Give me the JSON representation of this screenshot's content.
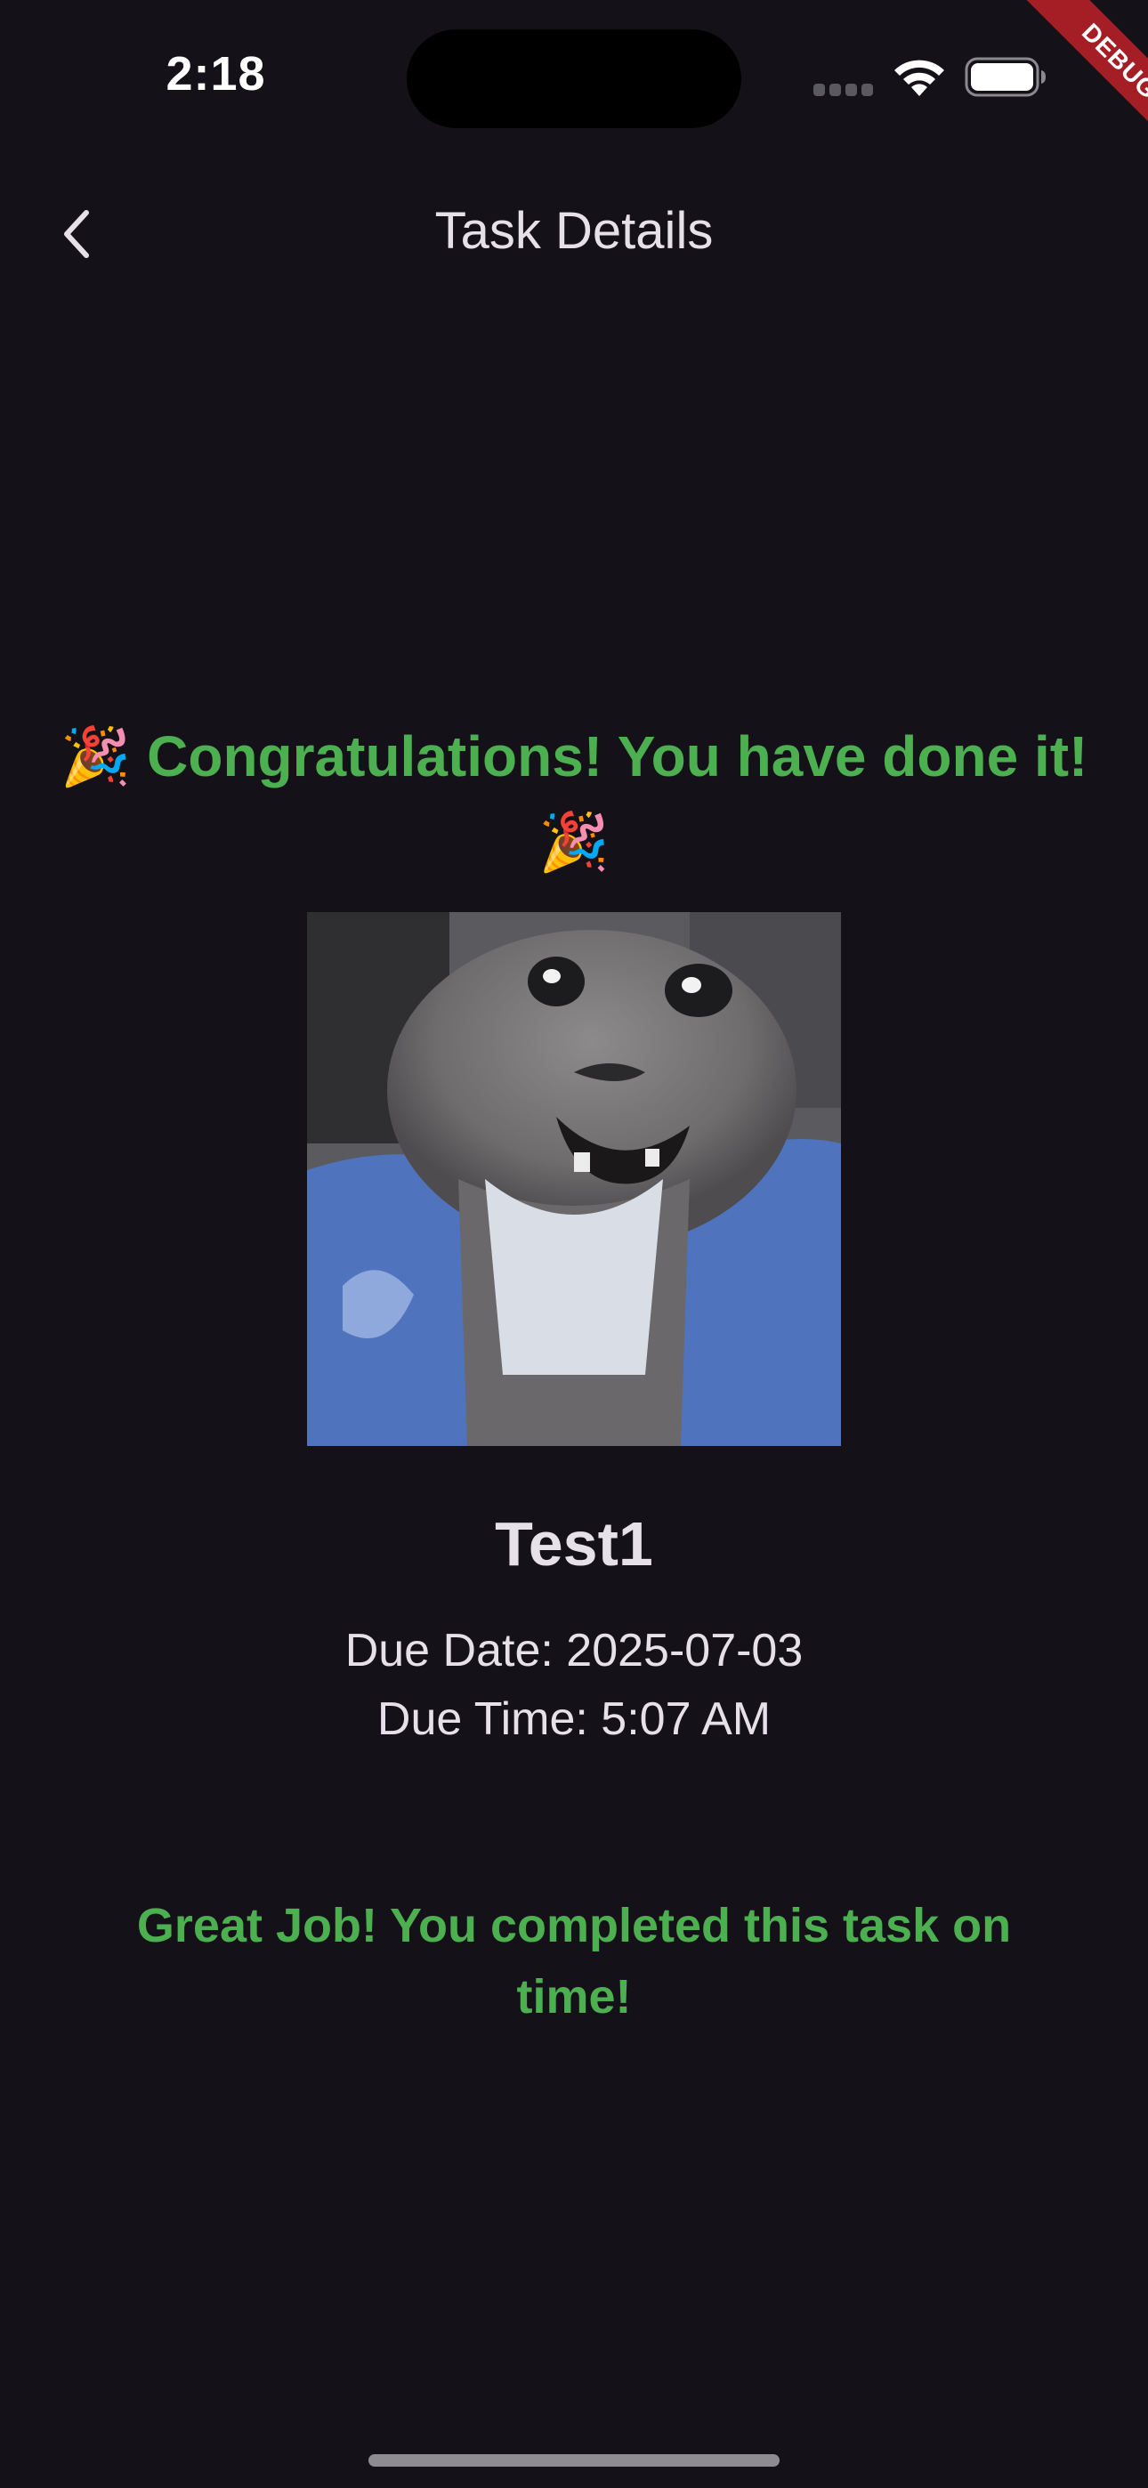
{
  "status_bar": {
    "time": "2:18",
    "signal_icon": "cellular-signal-icon",
    "wifi_icon": "wifi-icon",
    "battery_icon": "battery-icon"
  },
  "debug_banner": {
    "label": "DEBUG",
    "color": "#a51e25"
  },
  "app_bar": {
    "back_icon": "chevron-left-icon",
    "title": "Task Details"
  },
  "main": {
    "congrats_message": "🎉 Congratulations! You have done it! 🎉",
    "image_alt": "Happy cat",
    "task_title": "Test1",
    "due_date": "Due Date: 2025-07-03",
    "due_time": "Due Time: 5:07 AM",
    "completion_message": "Great Job! You completed this task on time!"
  },
  "colors": {
    "background": "#141218",
    "accent_green": "#4caf50",
    "text": "#e6e0e9"
  }
}
